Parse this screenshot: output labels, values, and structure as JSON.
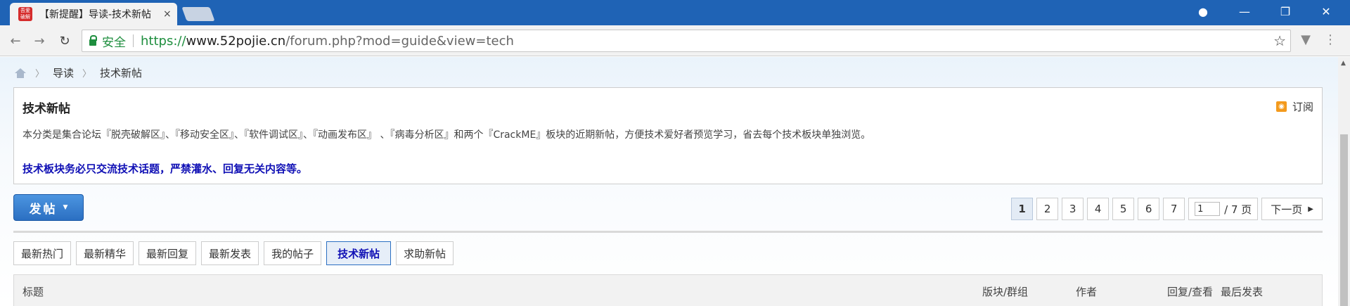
{
  "browser": {
    "tab_title": "【新提醒】导读-技术新帖",
    "tab_close": "×",
    "favicon_text": "吾爱破解",
    "secure_label": "安全",
    "url_proto": "https://",
    "url_host": "www.52pojie.cn",
    "url_path": "/forum.php?mod=guide&view=tech"
  },
  "icons": {
    "back": "←",
    "forward": "→",
    "reload": "↻",
    "star": "☆",
    "profile": "●",
    "minimize": "—",
    "restore": "❐",
    "close": "✕",
    "extension": "▼",
    "menu": "⋮"
  },
  "breadcrumb": {
    "items": [
      "导读",
      "技术新帖"
    ],
    "separator": "〉"
  },
  "info": {
    "title": "技术新帖",
    "rss_label": "订阅",
    "description": "本分类是集合论坛『脱壳破解区』、『移动安全区』、『软件调试区』、『动画发布区』 、『病毒分析区』和两个『CrackME』板块的近期新帖，方便技术爱好者预览学习，省去每个技术板块单独浏览。",
    "notice": "技术板块务必只交流技术话题，严禁灌水、回复无关内容等。"
  },
  "post_button": {
    "label": "发帖",
    "caret": "▼"
  },
  "pager": {
    "pages": [
      "1",
      "2",
      "3",
      "4",
      "5",
      "6",
      "7"
    ],
    "current": "1",
    "input_value": "1",
    "total_label": "/ 7 页",
    "next_label": "下一页",
    "next_icon": "▶"
  },
  "tabs": [
    "最新热门",
    "最新精华",
    "最新回复",
    "最新发表",
    "我的帖子",
    "技术新帖",
    "求助新帖"
  ],
  "active_tab": "技术新帖",
  "table_header": {
    "title": "标题",
    "forum": "版块/群组",
    "author": "作者",
    "replies": "回复/查看",
    "last_post": "最后发表"
  },
  "colors": {
    "titlebar": "#1f63b5",
    "accent": "#2b6fc2",
    "notice": "#1010b5",
    "rss": "#f39a1d",
    "secure": "#1e8e3e"
  }
}
